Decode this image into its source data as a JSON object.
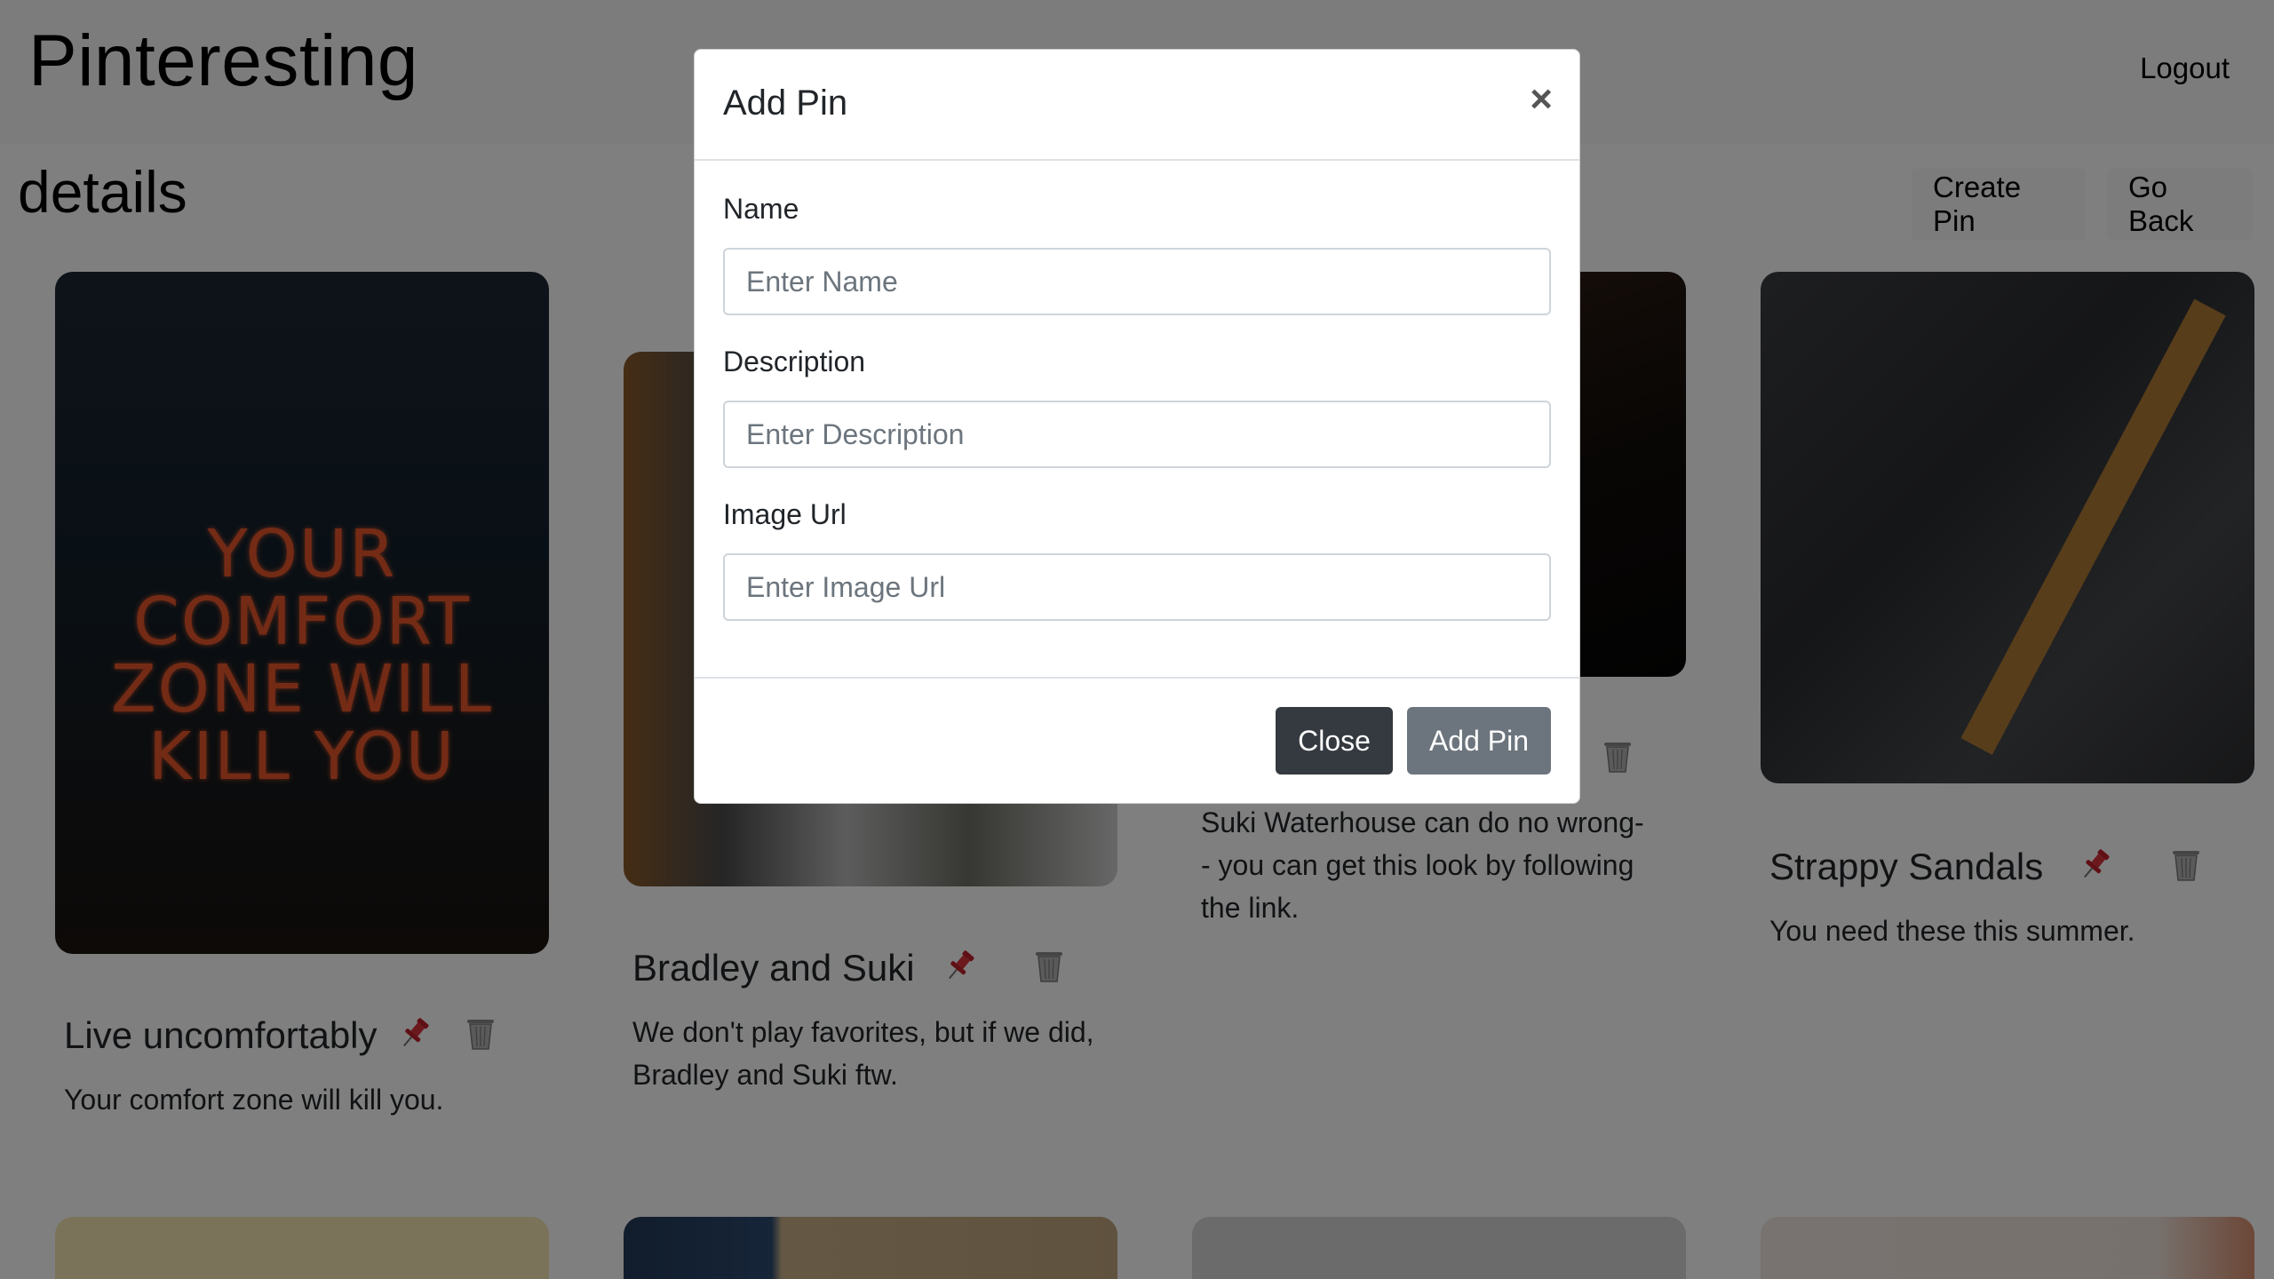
{
  "app": {
    "brand": "Pinteresting",
    "logout_label": "Logout"
  },
  "page": {
    "title": "details",
    "create_pin_label": "Create Pin",
    "go_back_label": "Go Back"
  },
  "cards": [
    {
      "title": "Live uncomfortably",
      "description": "Your comfort zone will kill you.",
      "image_text": "YOUR COMFORT ZONE WILL KILL YOU"
    },
    {
      "title": "Bradley and Suki",
      "description": "We don't play favorites, but if we did, Bradley and Suki ftw."
    },
    {
      "title": "",
      "description": "Suki Waterhouse can do no wrong-- you can get this look by following the link."
    },
    {
      "title": "Strappy Sandals",
      "description": "You need these this summer."
    }
  ],
  "modal": {
    "title": "Add Pin",
    "close_symbol": "×",
    "fields": {
      "name": {
        "label": "Name",
        "placeholder": "Enter Name"
      },
      "description": {
        "label": "Description",
        "placeholder": "Enter Description"
      },
      "image_url": {
        "label": "Image Url",
        "placeholder": "Enter Image Url"
      }
    },
    "close_button_label": "Close",
    "add_button_label": "Add Pin"
  },
  "colors": {
    "close_button": "#343a40",
    "add_button": "#6c757d",
    "pin_icon": "#c0202a"
  },
  "icons": [
    "pin-icon",
    "trash-icon",
    "close-icon"
  ]
}
